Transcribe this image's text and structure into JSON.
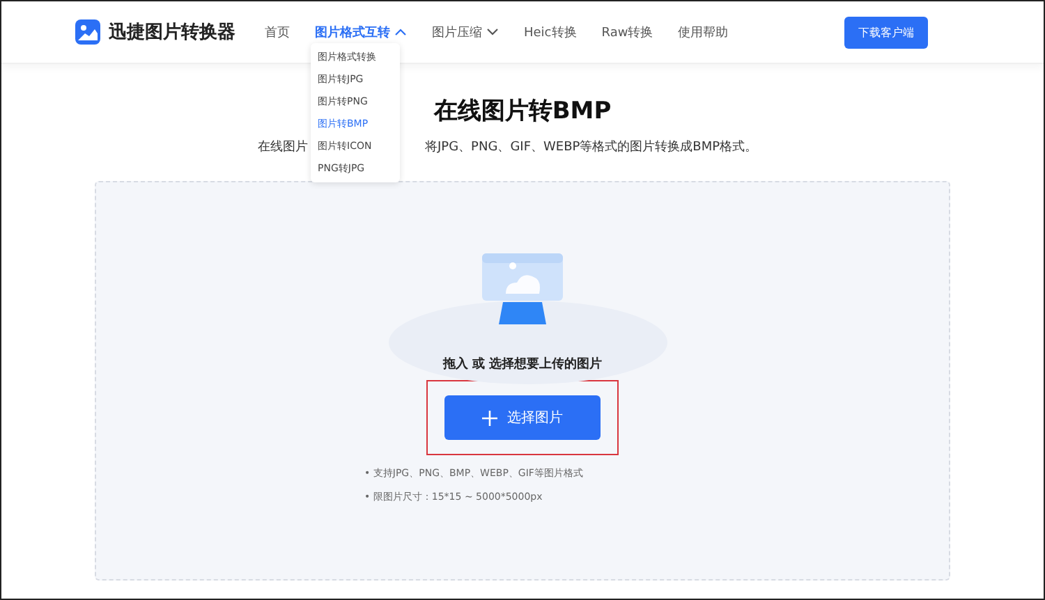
{
  "brand": {
    "name": "迅捷图片转换器"
  },
  "nav": [
    {
      "label": "首页",
      "selected": false,
      "has_menu": false,
      "expanded": false
    },
    {
      "label": "图片格式互转",
      "selected": true,
      "has_menu": true,
      "expanded": true
    },
    {
      "label": "图片压缩",
      "selected": false,
      "has_menu": true,
      "expanded": false
    },
    {
      "label": "Heic转换",
      "selected": false,
      "has_menu": false,
      "expanded": false
    },
    {
      "label": "Raw转换",
      "selected": false,
      "has_menu": false,
      "expanded": false
    },
    {
      "label": "使用帮助",
      "selected": false,
      "has_menu": false,
      "expanded": false
    }
  ],
  "download_button": "下载客户端",
  "dropdown": [
    {
      "label": "图片格式转换",
      "selected": false
    },
    {
      "label": "图片转JPG",
      "selected": false
    },
    {
      "label": "图片转PNG",
      "selected": false
    },
    {
      "label": "图片转BMP",
      "selected": true
    },
    {
      "label": "图片转ICON",
      "selected": false
    },
    {
      "label": "PNG转JPG",
      "selected": false
    }
  ],
  "title": "在线图片转BMP",
  "subtitle": [
    "在线图片",
    "将JPG、PNG、GIF、WEBP等格式的图片转换成BMP格式。"
  ],
  "upload": {
    "prompt": "拖入 或 选择想要上传的图片",
    "button": "选择图片",
    "highlighted": true,
    "notes": [
      "• 支持JPG、PNG、BMP、WEBP、GIF等图片格式",
      "• 限图片尺寸：15*15 ~ 5000*5000px"
    ]
  }
}
